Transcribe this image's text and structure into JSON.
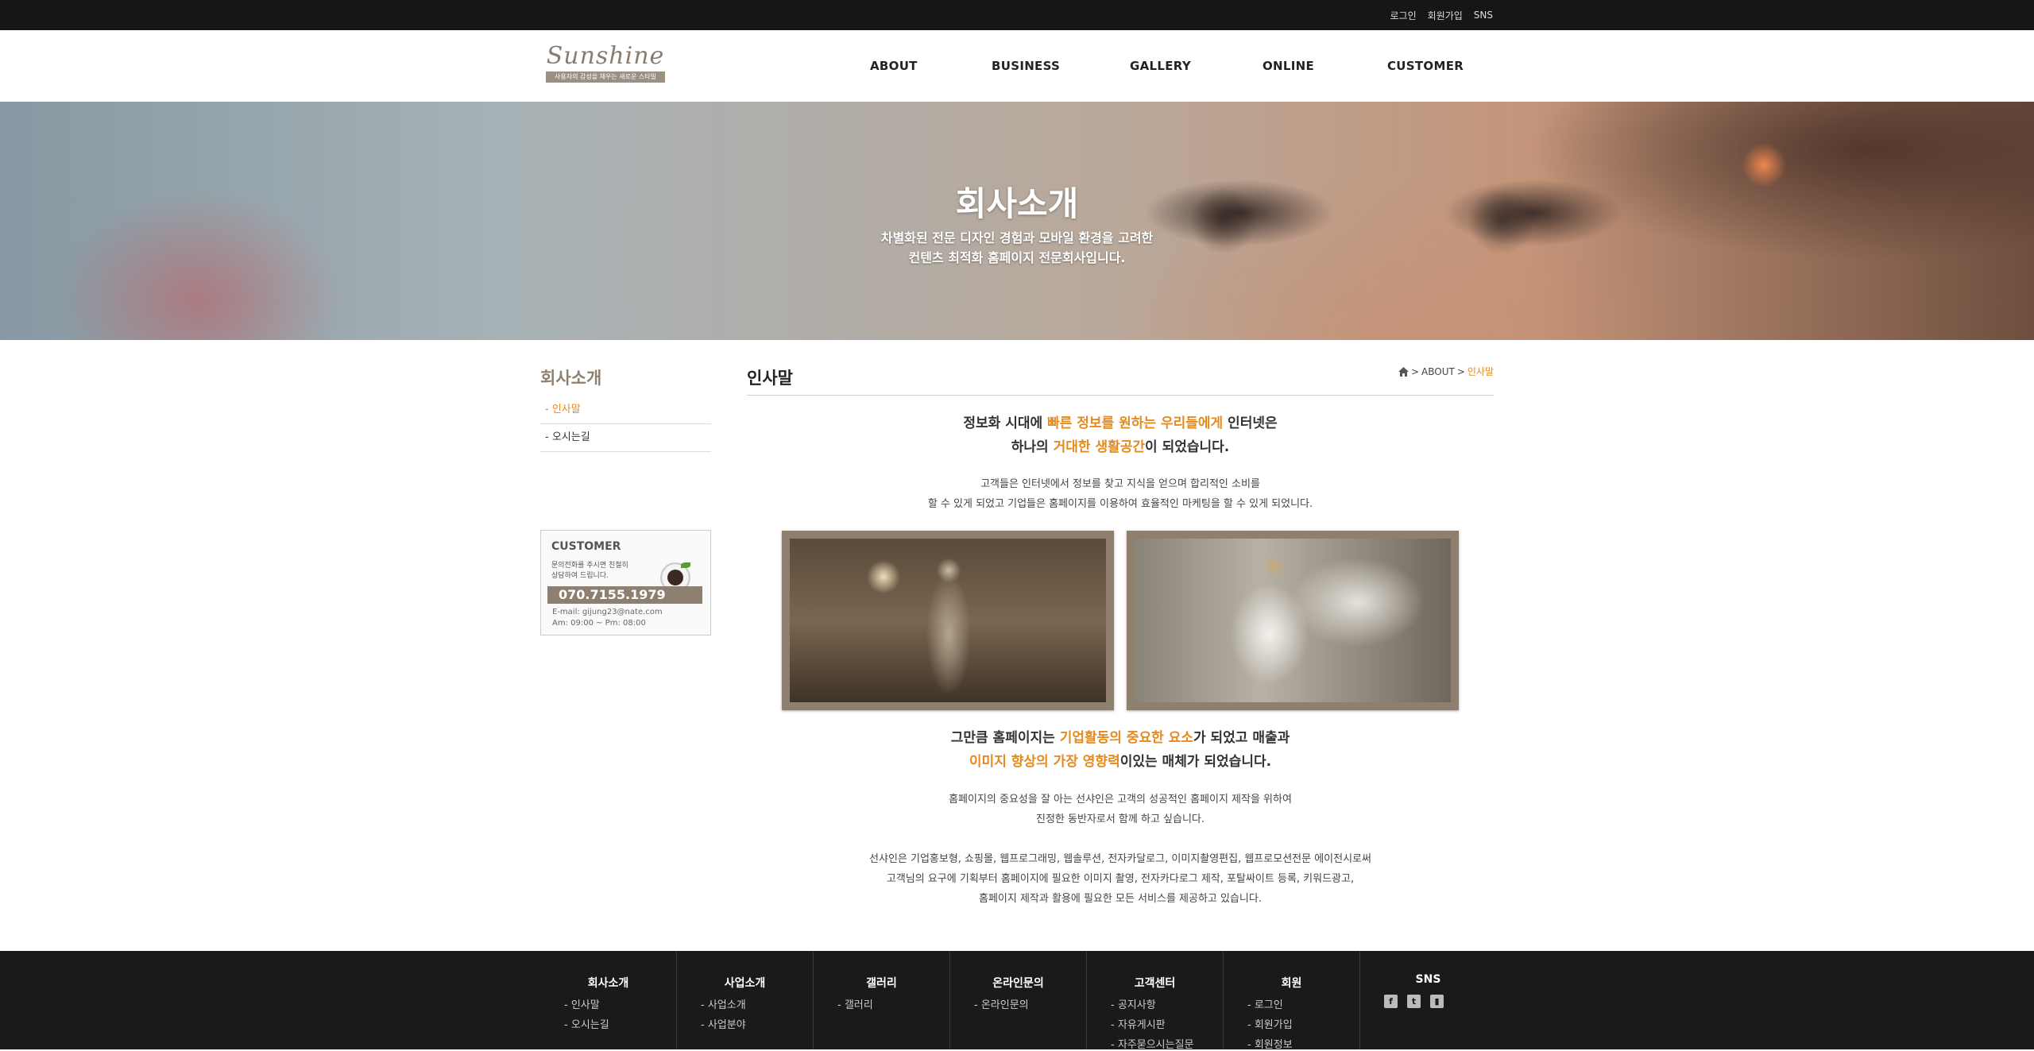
{
  "topbar": {
    "login": "로그인",
    "signup": "회원가입",
    "sns": "SNS"
  },
  "logo": {
    "name": "Sunshine",
    "tagline": "사용자의 감성을 채우는 새로운 스타일"
  },
  "nav": {
    "items": [
      "ABOUT",
      "BUSINESS",
      "GALLERY",
      "ONLINE",
      "CUSTOMER"
    ]
  },
  "hero": {
    "title": "회사소개",
    "line1": "차별화된 전문 디자인 경험과 모바일 환경을 고려한",
    "line2": "컨텐츠 최적화 홈페이지 전문회사입니다."
  },
  "sidebar": {
    "title": "회사소개",
    "items": [
      "- 인사말",
      "- 오시는길"
    ]
  },
  "customer": {
    "title": "CUSTOMER",
    "desc1": "문의전화를 주시면 친절히",
    "desc2": "상담하여 드립니다.",
    "phone": "070.7155.1979",
    "email": "E-mail: gijung23@nate.com",
    "hours": "Am: 09:00 ~ Pm: 08:00"
  },
  "content": {
    "page_title": "인사말",
    "breadcrumb": {
      "sep": ">",
      "section": "ABOUT",
      "current": "인사말"
    },
    "h1": {
      "a": "정보화 시대에 ",
      "b": "빠른 정보를 원하는 우리들에게",
      "c": " 인터넷은",
      "d": "하나의 ",
      "e": "거대한 생활공간",
      "f": "이 되었습니다."
    },
    "p1": [
      "고객들은 인터넷에서 정보를 찾고 지식을 얻으며 합리적인 소비를",
      "할 수 있게 되었고 기업들은 홈페이지를 이용하여 효율적인 마케팅을 할 수 있게 되었니다."
    ],
    "h2": {
      "a": "그만큼 홈페이지는 ",
      "b": "기업활동의 중요한 요소",
      "c": "가 되었고 매출과",
      "d": "이미지 향상의 가장 영향력",
      "e": "이있는 매체가 되었습니다."
    },
    "p2": [
      "홈페이지의 중요성을 잘 아는 선샤인은 고객의 성공적인 홈페이지 제작을 위하여",
      "진정한 동반자로서 함께 하고 싶습니다."
    ],
    "p3": [
      "선샤인은 기업홍보형, 쇼핑몰, 웹프로그래밍, 웹솔루션, 전자카달로그, 이미지촬영편집, 웹프로모션전문 에이전시로써",
      "고객님의 요구에 기획부터 홈페이지에 필요한 이미지 촬영, 전자카다로그 제작, 포탈싸이트 등록, 키워드광고,",
      "홈페이지 제작과 활용에 필요한 모든 서비스를 제공하고 있습니다."
    ]
  },
  "footer": {
    "cols": [
      {
        "title": "회사소개",
        "links": [
          "- 인사말",
          "- 오시는길"
        ]
      },
      {
        "title": "사업소개",
        "links": [
          "- 사업소개",
          "- 사업분야"
        ]
      },
      {
        "title": "갤러리",
        "links": [
          "- 갤러리"
        ]
      },
      {
        "title": "온라인문의",
        "links": [
          "- 온라인문의"
        ]
      },
      {
        "title": "고객센터",
        "links": [
          "- 공지사항",
          "- 자유게시판",
          "- 자주묻으시는질문"
        ]
      },
      {
        "title": "회원",
        "links": [
          "- 로그인",
          "- 회원가입",
          "- 회원정보"
        ]
      }
    ],
    "sns_title": "SNS",
    "sns_icons": [
      "facebook-icon",
      "twitter-icon",
      "twitch-icon"
    ]
  }
}
